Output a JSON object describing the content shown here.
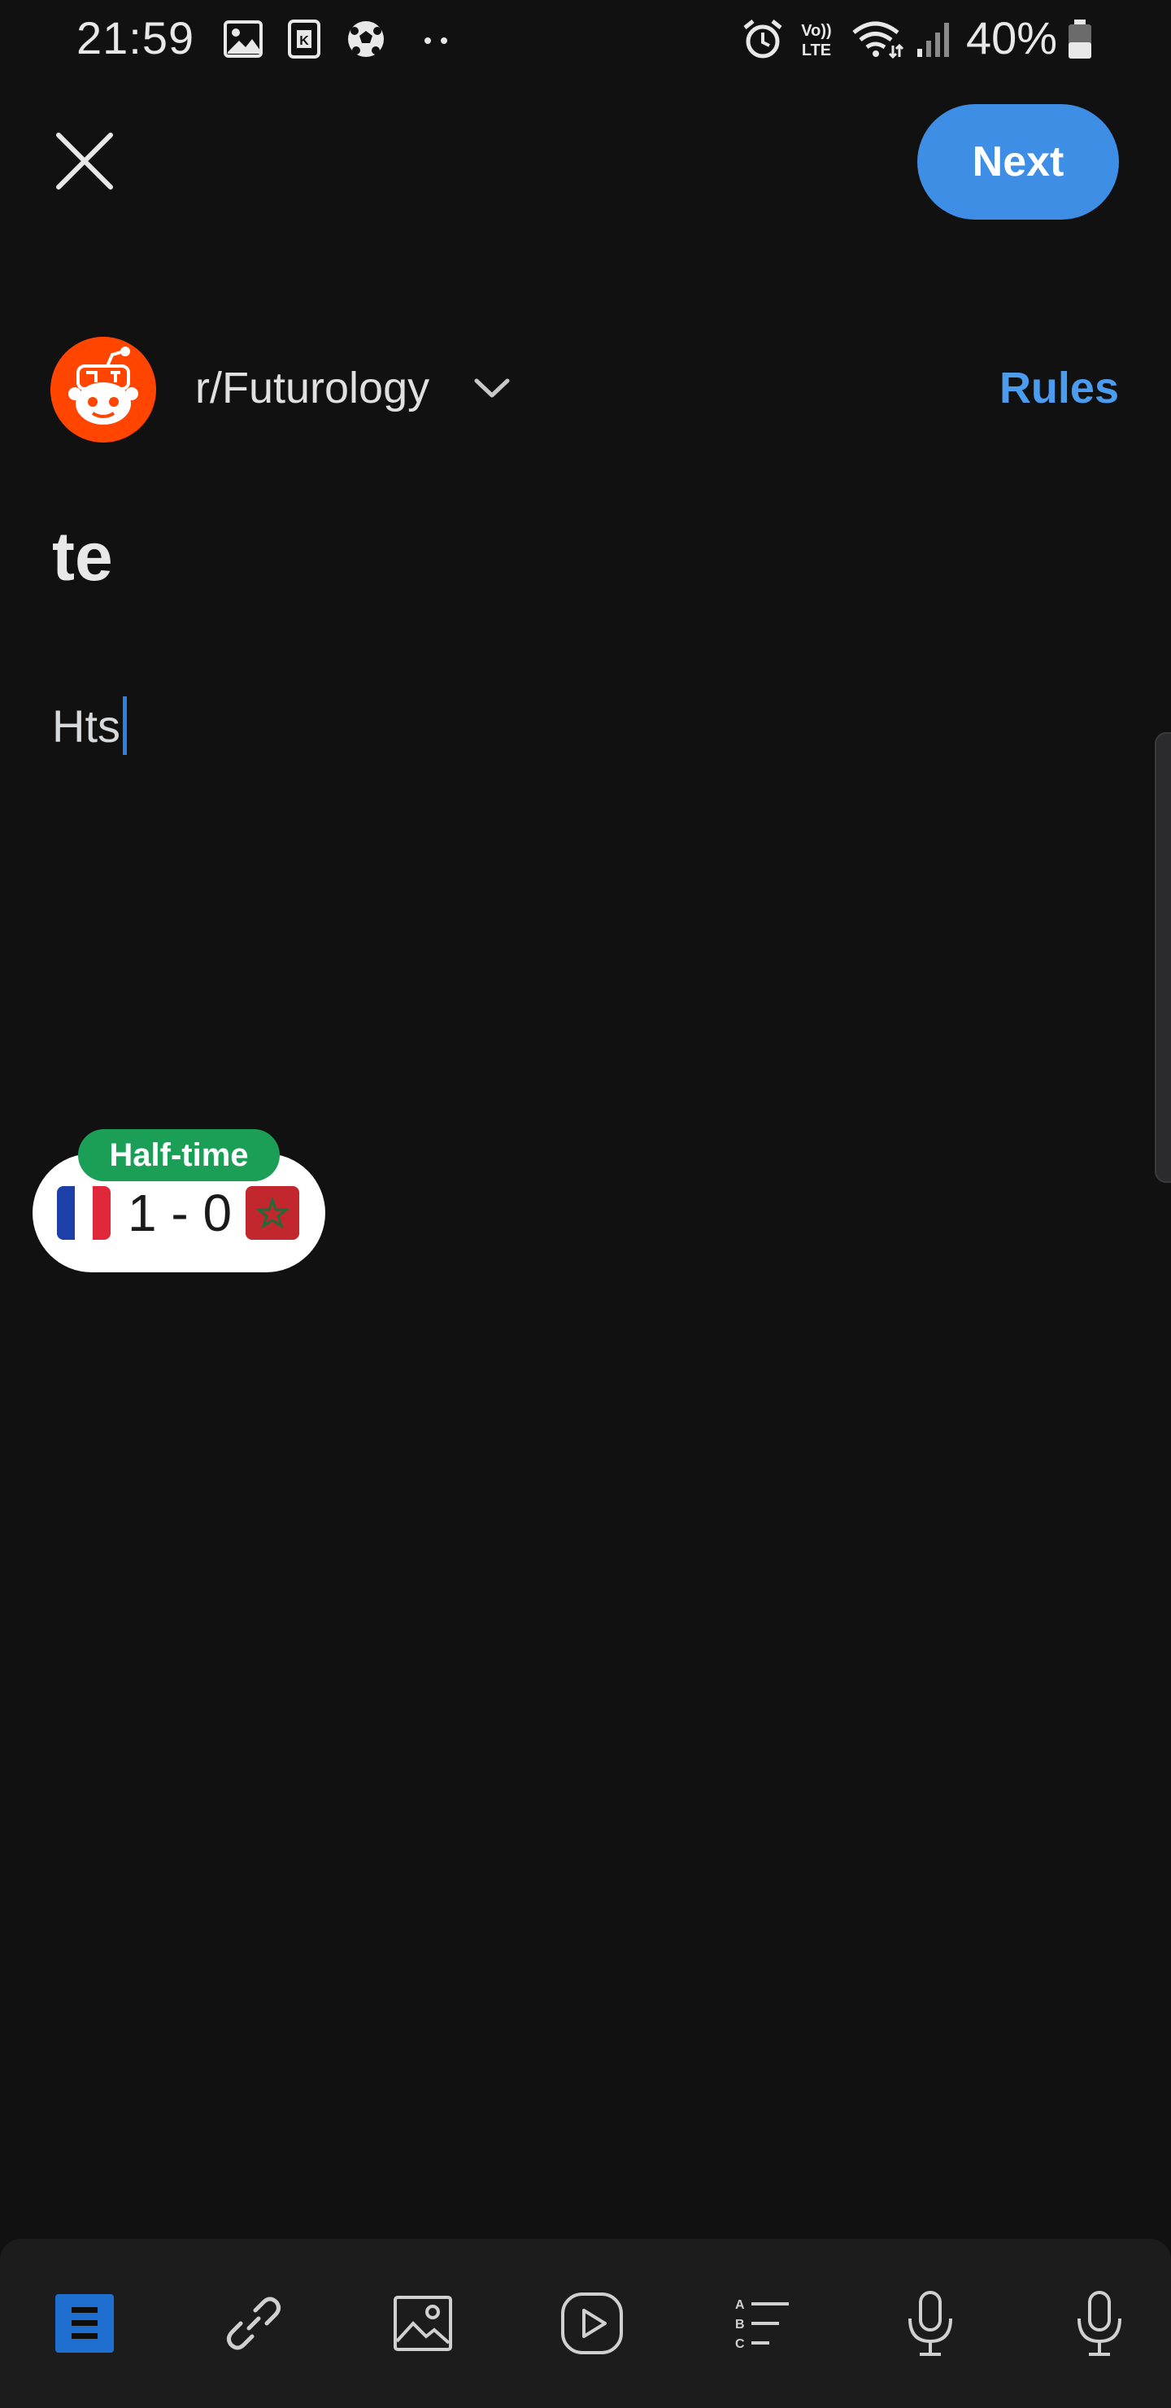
{
  "status_bar": {
    "time": "21:59",
    "battery_percent": "40%",
    "icons": [
      "image-icon",
      "k-app-icon",
      "soccer-ball-icon",
      "more-dots-icon",
      "alarm-icon",
      "volte-icon",
      "wifi-icon",
      "signal-icon",
      "battery-icon"
    ],
    "volte_label": "Vo)) LTE"
  },
  "header": {
    "close_icon": "close-icon",
    "next_label": "Next",
    "accent_color": "#3f8ee6"
  },
  "community": {
    "name": "r/Futurology",
    "rules_label": "Rules",
    "avatar_color": "#ff4500",
    "dropdown_icon": "chevron-down-icon"
  },
  "post": {
    "title": "te",
    "body": "Hts"
  },
  "score_widget": {
    "status": "Half-time",
    "score": "1 - 0",
    "home_flag": "france-flag-icon",
    "away_flag": "morocco-flag-icon",
    "status_color": "#1b9f57"
  },
  "toolbar": {
    "tools": [
      "text-icon",
      "link-icon",
      "image-icon",
      "video-icon",
      "poll-icon",
      "microphone-icon",
      "microphone-icon"
    ]
  }
}
